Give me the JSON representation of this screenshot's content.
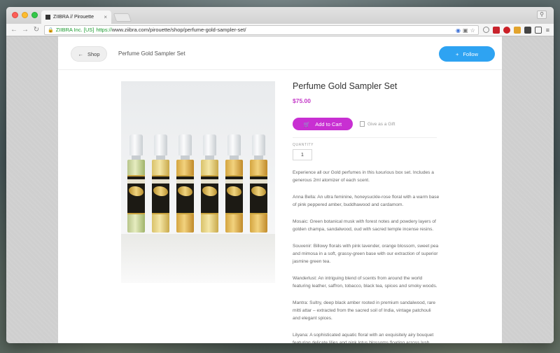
{
  "browser": {
    "tab_title": "ZIIBRA // Pirouette",
    "tab_close": "×",
    "profile_icon": "person-icon",
    "url_ev_name": "ZIIBRA Inc. [US]",
    "url_scheme": "https://",
    "url_rest": "www.ziibra.com/pirouette/shop/perfume-gold-sampler-set/",
    "nav": {
      "back": "←",
      "forward": "→",
      "reload": "↻"
    },
    "menu": "≡"
  },
  "header": {
    "back_label": "Shop",
    "back_arrow": "←",
    "breadcrumb_title": "Perfume Gold Sampler Set",
    "follow_label": "Follow",
    "follow_plus": "+"
  },
  "product": {
    "title": "Perfume Gold Sampler Set",
    "price": "$75.00",
    "add_to_cart_label": "Add to Cart",
    "cart_icon": "cart-icon",
    "gift_label": "Give as a Gift",
    "quantity_label": "QUANTITY",
    "quantity_value": "1",
    "vial_labels": [
      "LILYANA",
      "MOSAIC",
      "WANDERLUST",
      "SOUVENIR",
      "ANNA BELLA",
      "MANTRA"
    ],
    "description": [
      "Experience all our Gold perfumes in this luxurious box set. Includes a generous 2ml atomizer of each scent.",
      "Anna Bella: An ultra feminine, honeysuckle-rose floral with a warm base of pink peppered amber, buddhawood and cardamom.",
      "Mosaic: Green botanical musk with forest notes and powdery layers of golden champa, sandalwood, oud with sacred temple incense resins.",
      "Souvenir: Billowy florals with pink lavender, orange blossom, sweet pea and mimosa in a soft, grassy-green base with our extraction of superior jasmine green tea.",
      "Wanderlust: An intriguing blend of scents from around the world featuring leather, saffron, tobacco, black tea, spices and smoky woods.",
      "Mantra: Sultry, deep black amber rooted in premium sandalwood, rare mitti attar – extracted from the sacred soil of India, vintage patchouli and elegant spices.",
      "Lilyana: A sophisticated aquatic floral with an exquisitely airy bouquet featuring delicate lilies and pink lotus blossoms floating across lush"
    ]
  },
  "colors": {
    "accent_purple": "#c82fd2",
    "price_purple": "#c43ac8",
    "follow_blue": "#2ea3f2"
  }
}
